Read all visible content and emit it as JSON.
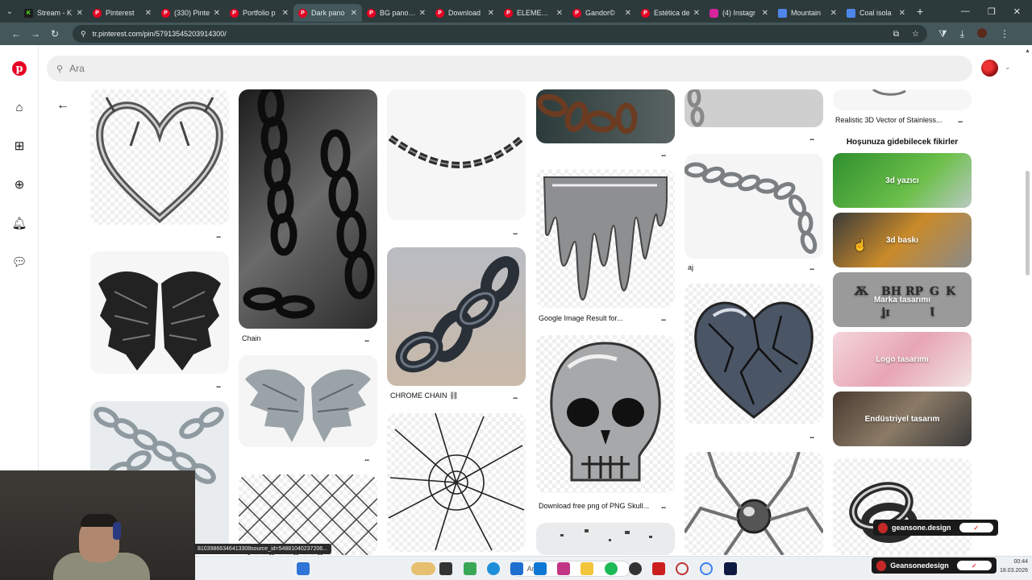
{
  "browser": {
    "tabs": [
      {
        "title": "Stream - K",
        "icon": "k"
      },
      {
        "title": "Pinterest",
        "icon": "p"
      },
      {
        "title": "(330) Pinte",
        "icon": "p"
      },
      {
        "title": "Portfolio p",
        "icon": "p"
      },
      {
        "title": "Dark pano",
        "icon": "p",
        "active": true
      },
      {
        "title": "BG panosu",
        "icon": "p"
      },
      {
        "title": "Download",
        "icon": "p"
      },
      {
        "title": "ELEMENTS",
        "icon": "p"
      },
      {
        "title": "Gandor©",
        "icon": "p"
      },
      {
        "title": "Estética de",
        "icon": "p"
      },
      {
        "title": "(4) Instagr",
        "icon": "ig"
      },
      {
        "title": "Mountain",
        "icon": "doc"
      },
      {
        "title": "Coal isola",
        "icon": "doc"
      }
    ],
    "url": "tr.pinterest.com/pin/579135452039143​00/"
  },
  "search": {
    "placeholder": "Ara"
  },
  "pins": {
    "col1": {
      "dots1": "...",
      "dots2": "...",
      "dots3": "..."
    },
    "col2": {
      "caption1": "Chain",
      "dots1": "...",
      "dots2": "..."
    },
    "col3": {
      "caption1": "CHROME CHAIN ⛓",
      "dots1": "...",
      "dots2": "..."
    },
    "col4": {
      "caption1": "Google Image Result for...",
      "caption2": "Download free png of PNG Skull...",
      "dots0": "...",
      "dots1": "...",
      "dots2": "..."
    },
    "col5": {
      "caption1": "aj",
      "dots1": "...",
      "dots2": "...",
      "dots3": "..."
    },
    "col6": {
      "caption1": "Realistic 3D Vector of Stainless...",
      "dots1": "..."
    }
  },
  "ideas": {
    "title": "Hoşunuza gidebilecek fikirler",
    "items": [
      "3d yazıcı",
      "3d baskı",
      "Marka tasarımı",
      "Logo tasarımı",
      "Endüstriyel tasarım"
    ]
  },
  "overlay": {
    "status_url": "81039866346413308source_id=548810402372​06...",
    "taskbar_search": "Ara",
    "clock_time": "00:44",
    "clock_date": "18.03.2026",
    "notif1": "geansone.design",
    "notif2": "Geansonedesign"
  }
}
